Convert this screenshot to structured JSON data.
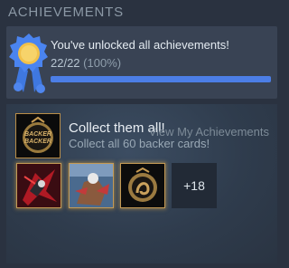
{
  "section": {
    "title": "ACHIEVEMENTS"
  },
  "summary": {
    "unlocked_text": "You've unlocked all achievements!",
    "count": "22/22",
    "percent_text": "(100%)",
    "progress": 1.0,
    "medal_icon": "medal-ribbon-icon",
    "progress_color": "#4c7ee6"
  },
  "featured": {
    "icon": "backer-medal-icon",
    "icon_text": "BACKER",
    "title": "Collect them all!",
    "description": "Collect all 60 backer cards!"
  },
  "recent_achievements": [
    {
      "icon": "red-warrior-achievement-icon"
    },
    {
      "icon": "fighter-achievement-icon"
    },
    {
      "icon": "bronze-medal-achievement-icon"
    }
  ],
  "more_count": "+18",
  "view_link": "View My Achievements"
}
